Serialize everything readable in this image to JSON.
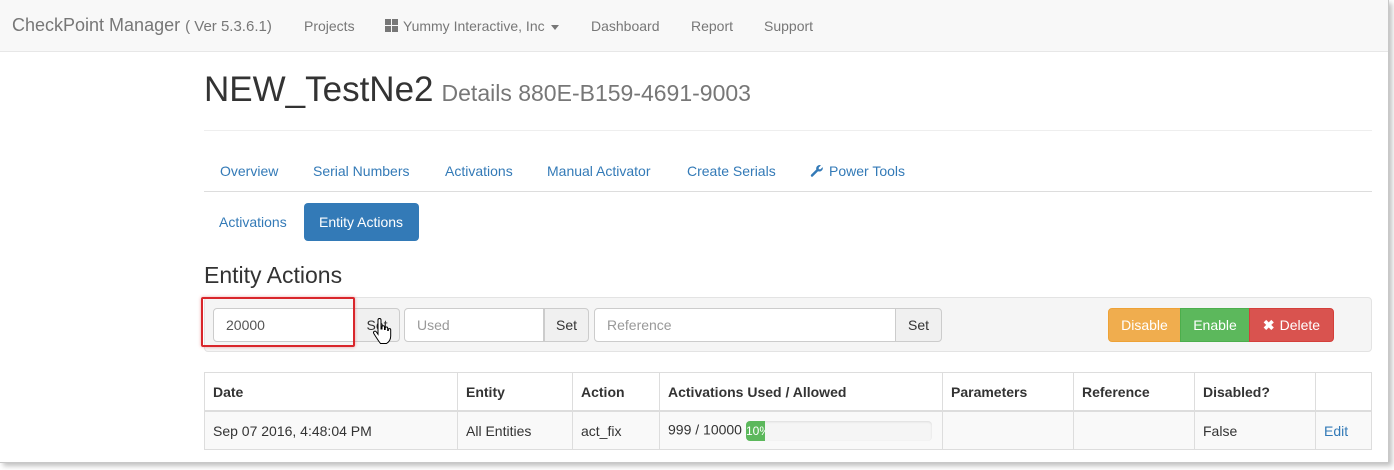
{
  "navbar": {
    "brand": "CheckPoint Manager",
    "version": "( Ver 5.3.6.1)",
    "items": [
      {
        "label": "Projects"
      },
      {
        "label": "Yummy Interactive, Inc",
        "icon": "grid-icon",
        "dropdown": true
      },
      {
        "label": "Dashboard"
      },
      {
        "label": "Report"
      },
      {
        "label": "Support"
      }
    ]
  },
  "header": {
    "title": "NEW_TestNe2",
    "subtitle": "Details 880E-B159-4691-9003"
  },
  "tabs": [
    {
      "label": "Overview"
    },
    {
      "label": "Serial Numbers"
    },
    {
      "label": "Activations"
    },
    {
      "label": "Manual Activator"
    },
    {
      "label": "Create Serials"
    },
    {
      "label": "Power Tools",
      "icon": "wrench-icon"
    }
  ],
  "pills": [
    {
      "label": "Activations",
      "active": false
    },
    {
      "label": "Entity Actions",
      "active": true
    }
  ],
  "section_title": "Entity Actions",
  "toolbar": {
    "allowed": {
      "value": "20000",
      "button": "Set"
    },
    "used": {
      "placeholder": "Used",
      "button": "Set"
    },
    "reference": {
      "placeholder": "Reference",
      "button": "Set"
    },
    "disable_label": "Disable",
    "enable_label": "Enable",
    "delete_label": "Delete"
  },
  "colors": {
    "primary": "#337ab7",
    "warning": "#f0ad4e",
    "success": "#5cb85c",
    "danger": "#d9534f",
    "highlight": "#d9262b"
  },
  "table": {
    "headers": [
      "Date",
      "Entity",
      "Action",
      "Activations Used / Allowed",
      "Parameters",
      "Reference",
      "Disabled?",
      ""
    ],
    "rows": [
      {
        "date": "Sep 07 2016, 4:48:04 PM",
        "entity": "All Entities",
        "action": "act_fix",
        "usage": "999 / 10000",
        "progress_label": "10%",
        "progress_percent": 10,
        "parameters": "",
        "reference": "",
        "disabled": "False",
        "edit_label": "Edit"
      }
    ]
  }
}
